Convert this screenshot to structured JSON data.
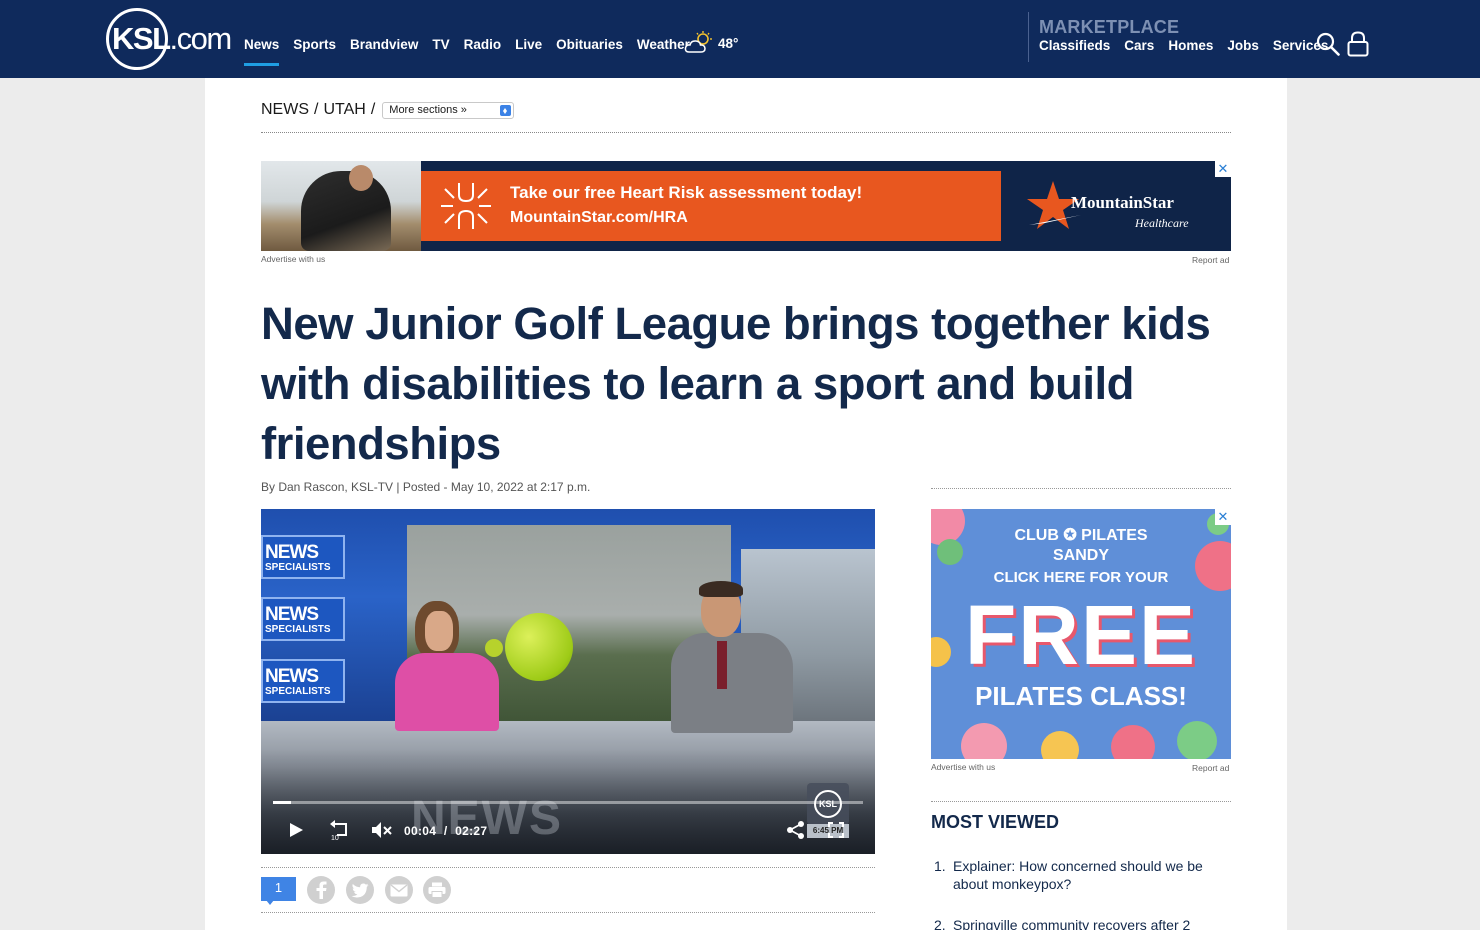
{
  "header": {
    "logo_text_bold": "KSL",
    "logo_text_suffix": ".com",
    "nav_items": [
      "News",
      "Sports",
      "Brandview",
      "TV",
      "Radio",
      "Live",
      "Obituaries",
      "Weather"
    ],
    "active_nav": "News",
    "weather_temp": "48°",
    "marketplace_title": "MARKETPLACE",
    "marketplace_items": [
      "Classifieds",
      "Cars",
      "Homes",
      "Jobs",
      "Services"
    ]
  },
  "breadcrumb": {
    "section": "NEWS",
    "subsection": "UTAH",
    "separator": "/",
    "select_value": "More sections »"
  },
  "top_ad": {
    "line1": "Take our free Heart Risk assessment today!",
    "line2": "MountainStar.com/HRA",
    "brand_name": "MountainStar",
    "brand_sub": "Healthcare",
    "close_label": "✕",
    "advertise_label": "Advertise with us",
    "report_label": "Report ad"
  },
  "article": {
    "headline": "New Junior Golf League brings together kids with disabilities to learn a sport and build friendships",
    "byline": "By Dan Rascon, KSL-TV | Posted - May 10, 2022 at 2:17 p.m."
  },
  "video": {
    "current_time": "00:04",
    "duration": "02:27",
    "time_separator": "/",
    "progress_fraction": 0.03,
    "tag_title": "NEWS",
    "tag_sub": "SPECIALISTS",
    "watermark": "NEWS",
    "corner_logo": "KSL",
    "corner_time": "6:45 PM",
    "icons": [
      "play-icon",
      "rewind-10-icon",
      "mute-icon",
      "share-icon",
      "fullscreen-icon"
    ]
  },
  "share": {
    "comment_count": "1",
    "icons": [
      "facebook-icon",
      "twitter-icon",
      "email-icon",
      "print-icon"
    ]
  },
  "side_ad": {
    "line1": "CLUB ✪ PILATES",
    "line2": "SANDY",
    "line3": "CLICK HERE FOR YOUR",
    "big_word": "FREE",
    "line4": "PILATES CLASS!",
    "close_label": "✕",
    "advertise_label": "Advertise with us",
    "report_label": "Report ad"
  },
  "most_viewed": {
    "title": "MOST VIEWED",
    "items": [
      {
        "num": "1.",
        "text": "Explainer: How concerned should we be about monkeypox?"
      },
      {
        "num": "2.",
        "text": "Springville community recovers after 2"
      }
    ]
  },
  "colors": {
    "header_bg": "#0f2a5c",
    "accent_blue": "#1f9ee3",
    "headline": "#13294b",
    "ad_orange": "#e8571f",
    "comment_blue": "#3f84e5"
  }
}
